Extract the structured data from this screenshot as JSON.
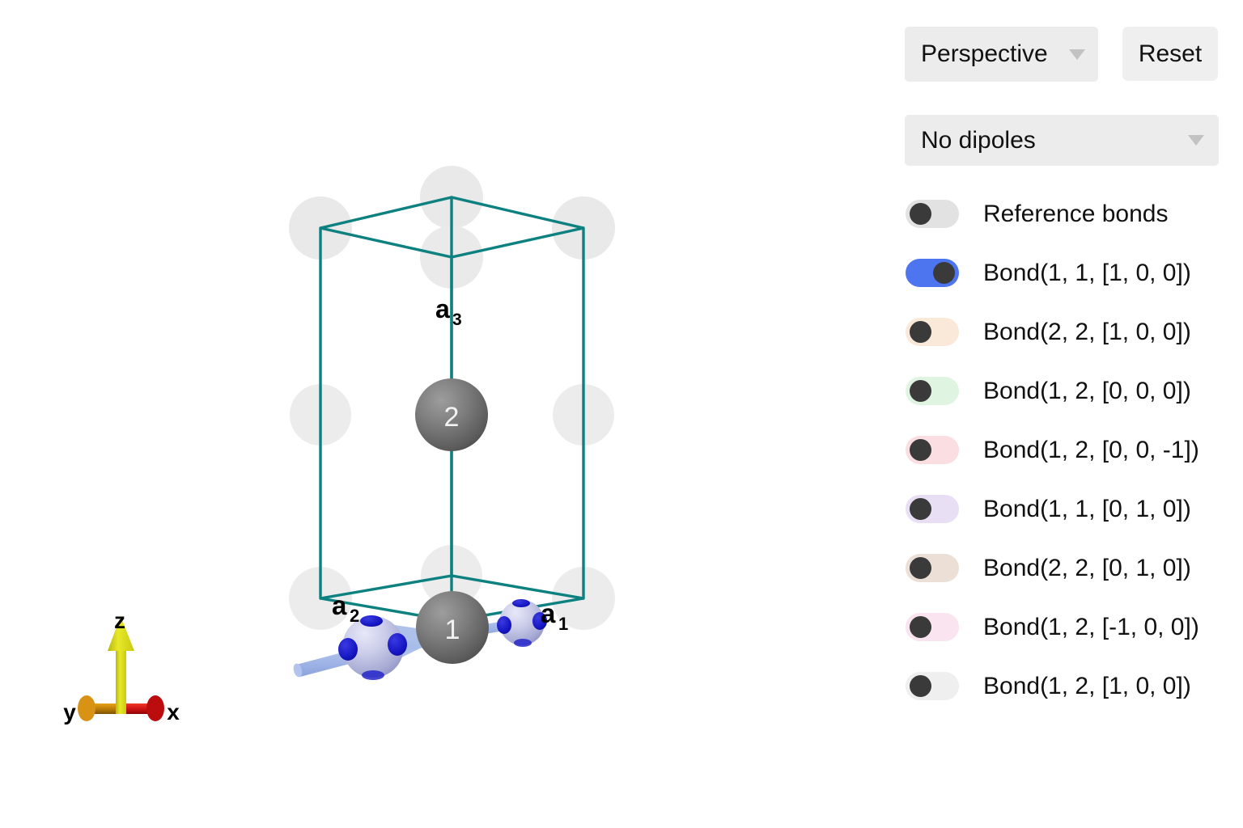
{
  "controls": {
    "projection": {
      "value": "Perspective",
      "icon": "chevron-down-icon"
    },
    "reset_label": "Reset",
    "dipoles": {
      "value": "No dipoles",
      "icon": "chevron-down-icon"
    }
  },
  "bond_toggles": [
    {
      "label": "Reference bonds",
      "on": false,
      "track_color": "#e2e2e2"
    },
    {
      "label": "Bond(1, 1, [1, 0, 0])",
      "on": true,
      "track_color": "#4d75f0"
    },
    {
      "label": "Bond(2, 2, [1, 0, 0])",
      "on": false,
      "track_color": "#fae8d8"
    },
    {
      "label": "Bond(1, 2, [0, 0, 0])",
      "on": false,
      "track_color": "#dff5e2"
    },
    {
      "label": "Bond(1, 2, [0, 0, -1])",
      "on": false,
      "track_color": "#fadee2"
    },
    {
      "label": "Bond(1, 1, [0, 1, 0])",
      "on": false,
      "track_color": "#e8dff5"
    },
    {
      "label": "Bond(2, 2, [0, 1, 0])",
      "on": false,
      "track_color": "#ece0d6"
    },
    {
      "label": "Bond(1, 2, [-1, 0, 0])",
      "on": false,
      "track_color": "#f9e4f0"
    },
    {
      "label": "Bond(1, 2, [1, 0, 0])",
      "on": false,
      "track_color": "#efefef"
    }
  ],
  "scene": {
    "lattice_labels": {
      "a1": "a",
      "a1_sub": "1",
      "a2": "a",
      "a2_sub": "2",
      "a3": "a",
      "a3_sub": "3"
    },
    "atom_labels": {
      "atom1": "1",
      "atom2": "2"
    },
    "axes": {
      "x": "x",
      "y": "y",
      "z": "z"
    },
    "colors": {
      "cell_edge": "#0d8080",
      "atom_dark": "#7a7a7a",
      "atom_light": "#b9bbdd",
      "bond": "#9db4ea",
      "bond_cap": "#1414c8",
      "ghost": "#e9e9e9",
      "axis_x": "#cc1111",
      "axis_y": "#cc8800",
      "axis_z": "#dede22"
    }
  }
}
